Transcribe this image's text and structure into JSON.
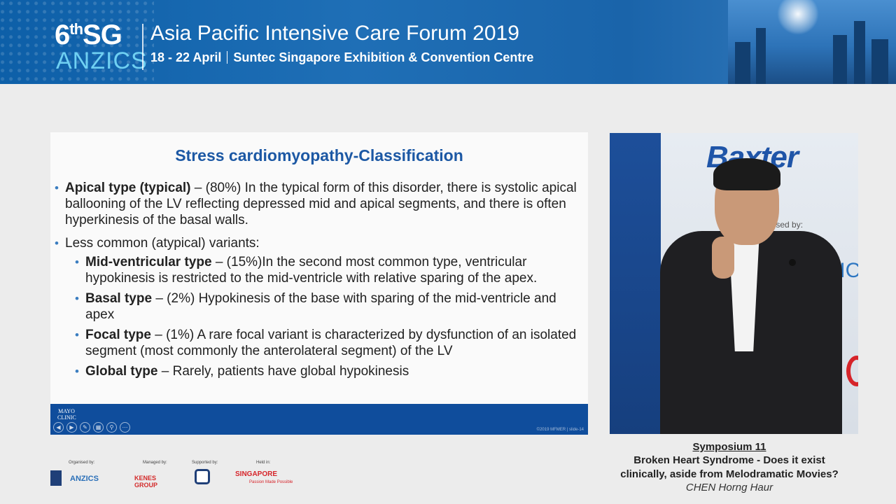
{
  "header": {
    "logo_edition": "6",
    "logo_sup": "th",
    "logo_sg": "SG",
    "logo_org": "ANZICS",
    "event_title": "Asia Pacific Intensive Care Forum 2019",
    "dates": "18 - 22 April",
    "venue": "Suntec Singapore Exhibition & Convention Centre"
  },
  "slide": {
    "title": "Stress cardiomyopathy-Classification",
    "bullets": [
      {
        "bold": "Apical type (typical)",
        "text": " – (80%) In the typical form of this disorder, there is systolic apical ballooning of the LV reflecting depressed mid and apical segments, and there is often hyperkinesis of the basal walls."
      },
      {
        "bold": "",
        "text": "Less common (atypical) variants:"
      }
    ],
    "subbullets": [
      {
        "bold": "Mid-ventricular type",
        "text": " – (15%)In the second most common type, ventricular hypokinesis is restricted to the mid-ventricle with relative sparing of the apex."
      },
      {
        "bold": "Basal type",
        "text": " – (2%) Hypokinesis of the base with sparing of the mid-ventricle and apex"
      },
      {
        "bold": "Focal type",
        "text": " – (1%) A rare focal variant is characterized by dysfunction of an isolated segment (most commonly the anterolateral segment) of the LV"
      },
      {
        "bold": "Global type",
        "text": " – Rarely, patients have global hypokinesis"
      }
    ],
    "footer_logo_line1": "MAYO",
    "footer_logo_line2": "CLINIC",
    "copyright": "©2019 MFMER | slide-14"
  },
  "video": {
    "backdrop_brand": "Baxter",
    "backdrop_organised": "nised by:",
    "backdrop_partial": "ZIC"
  },
  "sponsors": {
    "organised_label": "Organised by:",
    "organised_name": "ANZICS",
    "managed_label": "Managed by:",
    "managed_name": "KENES GROUP",
    "supported_label": "Supported by:",
    "held_label": "Held in:",
    "held_name": "SINGAPORE",
    "held_tagline": "Passion Made Possible"
  },
  "caption": {
    "symposium": "Symposium 11",
    "talk_title_line1": "Broken Heart Syndrome - Does it exist",
    "talk_title_line2": "clinically, aside from Melodramatic Movies?",
    "speaker": "CHEN Horng Haur"
  },
  "colors": {
    "banner_blue": "#1f6fb6",
    "slide_title_blue": "#1c58a4",
    "slide_footer_blue": "#0f4d9c",
    "bullet_blue": "#3a7dc0"
  }
}
